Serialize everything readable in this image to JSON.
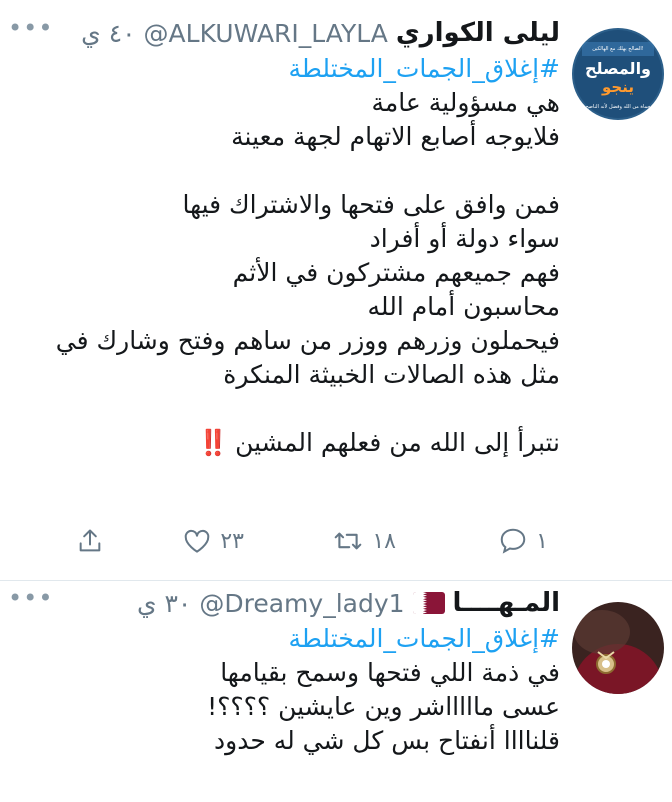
{
  "tweets": [
    {
      "name": "ليلى الكواري",
      "handle": "@ALKUWARI_LAYLA",
      "time": "٤٠ ي",
      "more": "•••",
      "hashtag": "#إغلاق_الجمات_المختلطة",
      "lines": [
        "هي مسؤولية عامة",
        "فلايوجه أصابع الاتهام لجهة معينة",
        "",
        "فمن وافق على فتحها والاشتراك فيها",
        "سواء دولة أو أفراد",
        "فهم جميعهم مشتركون في الأثم",
        "محاسبون أمام الله",
        "فيحملون وزرهم ووزر من ساهم  وفتح وشارك في",
        "مثل هذه الصالات الخبيثة المنكرة",
        "",
        "نتبرأ إلى الله من فعلهم المشين"
      ],
      "emoji": "‼️",
      "avatar": {
        "title": "والمصلح",
        "subtitle": "ينجو",
        "top_text": "الصالح يهلك مع الهالكين!",
        "bottom_text": "حماة من الله وفضل لأنه الناصح"
      },
      "actions": {
        "reply_count": "١",
        "retweet_count": "١٨",
        "like_count": "٢٣"
      }
    },
    {
      "name": "المـهــــا",
      "handle": "@Dreamy_lady1",
      "time": "٣٠ ي",
      "more": "•••",
      "hashtag": "#إغلاق_الجمات_المختلطة",
      "lines": [
        "في ذمة اللي فتحها وسمح بقيامها",
        "عسى ماااااشر وين عايشين ؟؟؟؟!",
        "قلناااا أنفتاح بس كل شي له حدود"
      ]
    }
  ],
  "colors": {
    "accent": "#1da1f2",
    "text": "#14171a",
    "secondary": "#657786",
    "separator": "#e1e8ed",
    "flag_maroon": "#8a1538"
  },
  "icons": {
    "reply": "reply-icon",
    "retweet": "retweet-icon",
    "like": "heart-icon",
    "share": "share-icon",
    "more": "more-icon",
    "flag": "qatar-flag-icon"
  }
}
